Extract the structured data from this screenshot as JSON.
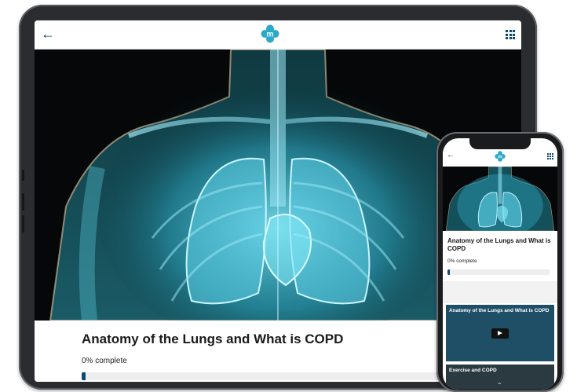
{
  "app": {
    "logo_letter": "m",
    "brand_color": "#2aa9c9",
    "accent_color": "#0a4a6e",
    "icons": [
      "back-arrow-icon",
      "app-logo-icon",
      "grid-menu-icon",
      "play-icon",
      "chevron-up-icon"
    ]
  },
  "tablet": {
    "back_glyph": "←",
    "course_title": "Anatomy of the Lungs and What is COPD",
    "progress_label": "0% complete",
    "progress_value": 0.01
  },
  "phone": {
    "back_glyph": "←",
    "course_title": "Anatomy of the Lungs and What is COPD",
    "progress_label": "0% complete",
    "progress_value": 0.02,
    "lessons": [
      {
        "title": "Anatomy of the Lungs and What is COPD"
      },
      {
        "title": "Exercise and COPD"
      }
    ],
    "chevron_glyph": "⌃"
  }
}
